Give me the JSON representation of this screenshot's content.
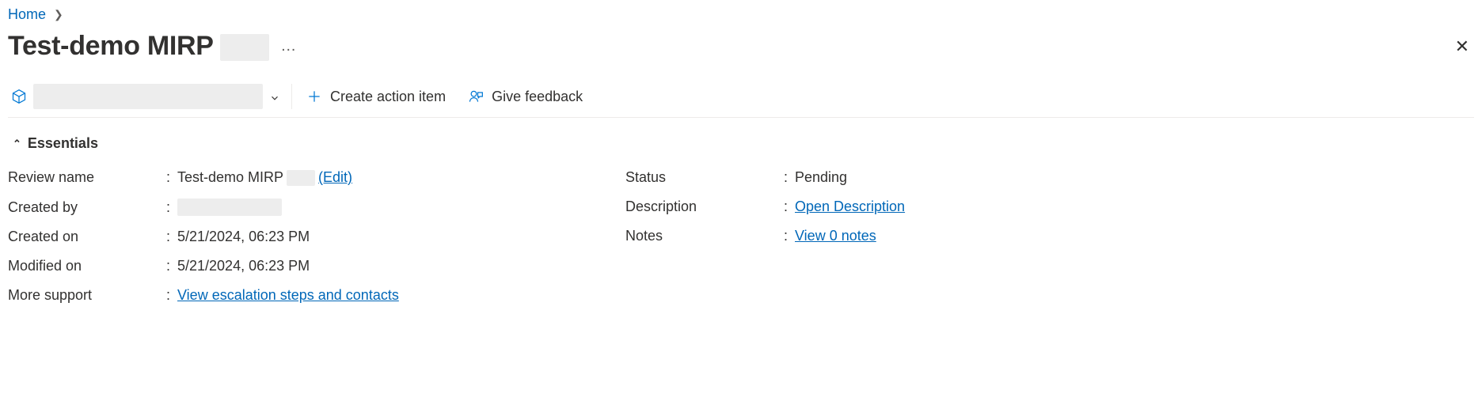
{
  "breadcrumb": {
    "home": "Home"
  },
  "title": "Test-demo MIRP",
  "toolbar": {
    "create_action": "Create action item",
    "give_feedback": "Give feedback"
  },
  "essentials_label": "Essentials",
  "left_fields": {
    "review_name": {
      "label": "Review name",
      "value": "Test-demo MIRP",
      "edit": "(Edit)"
    },
    "created_by": {
      "label": "Created by"
    },
    "created_on": {
      "label": "Created on",
      "value": "5/21/2024, 06:23 PM"
    },
    "modified_on": {
      "label": "Modified on",
      "value": "5/21/2024, 06:23 PM"
    },
    "more_support": {
      "label": "More support",
      "link": "View escalation steps and contacts"
    }
  },
  "right_fields": {
    "status": {
      "label": "Status",
      "value": "Pending"
    },
    "description": {
      "label": "Description",
      "link": "Open Description"
    },
    "notes": {
      "label": "Notes",
      "link": "View 0 notes"
    }
  }
}
